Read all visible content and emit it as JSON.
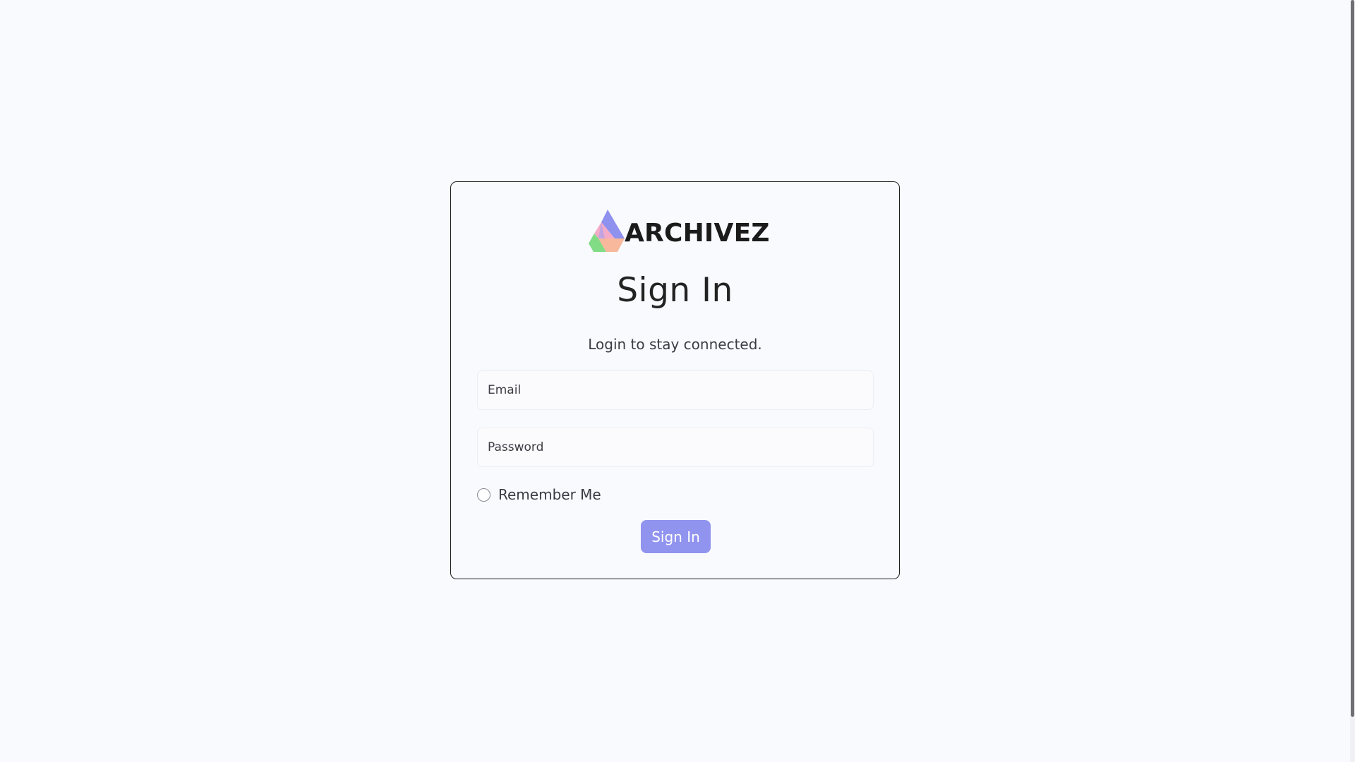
{
  "brand": {
    "name": "ARCHIVEZ",
    "logo_icon": "archivez-logo-icon"
  },
  "login": {
    "title": "Sign In",
    "subtitle": "Login to stay connected.",
    "email": {
      "placeholder": "Email",
      "value": ""
    },
    "password": {
      "placeholder": "Password",
      "value": ""
    },
    "remember_label": "Remember Me",
    "remember_checked": false,
    "submit_label": "Sign In"
  },
  "colors": {
    "background": "#f9fafe",
    "accent": "#9194ef",
    "card_border": "#1c1c1c",
    "text": "#232323"
  }
}
